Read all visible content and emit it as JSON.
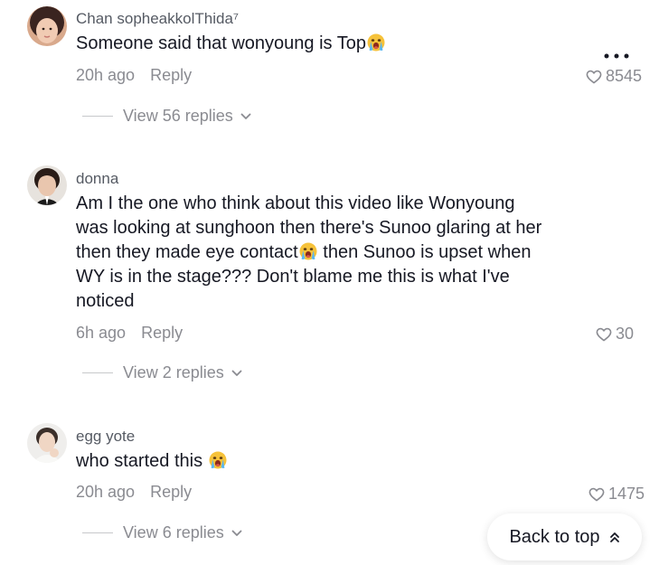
{
  "comments": [
    {
      "username": "Chan sopheakkolThida⁷",
      "text_parts": [
        "Someone said that wonyoung is Top",
        ""
      ],
      "time": "20h ago",
      "reply_label": "Reply",
      "likes": "8545",
      "view_replies": "View 56 replies",
      "emoji_icon": "loudly-crying-face-icon"
    },
    {
      "username": "donna",
      "lines": [
        "Am I the one who think about this video like Wonyoung",
        "was looking at sunghoon then there's Sunoo glaring at her",
        "then they made eye contact",
        "then Sunoo is upset when",
        "WY is in the stage??? Don't blame me this is what I've",
        "noticed"
      ],
      "time": "6h ago",
      "reply_label": "Reply",
      "likes": "30",
      "view_replies": "View 2 replies",
      "emoji_icon": "loudly-crying-face-icon"
    },
    {
      "username": "egg yote",
      "text_parts": [
        "who started this",
        ""
      ],
      "time": "20h ago",
      "reply_label": "Reply",
      "likes": "1475",
      "view_replies": "View 6 replies",
      "emoji_icon": "loudly-crying-face-icon"
    }
  ],
  "back_to_top_label": "Back to top",
  "icons": {
    "more": "more-options-icon",
    "heart": "heart-outline-icon",
    "chevron": "chevron-down-icon",
    "up": "double-chevron-up-icon"
  },
  "colors": {
    "primary_text": "#161823",
    "secondary_text": "#8a8b91",
    "username_text": "#555a63"
  }
}
